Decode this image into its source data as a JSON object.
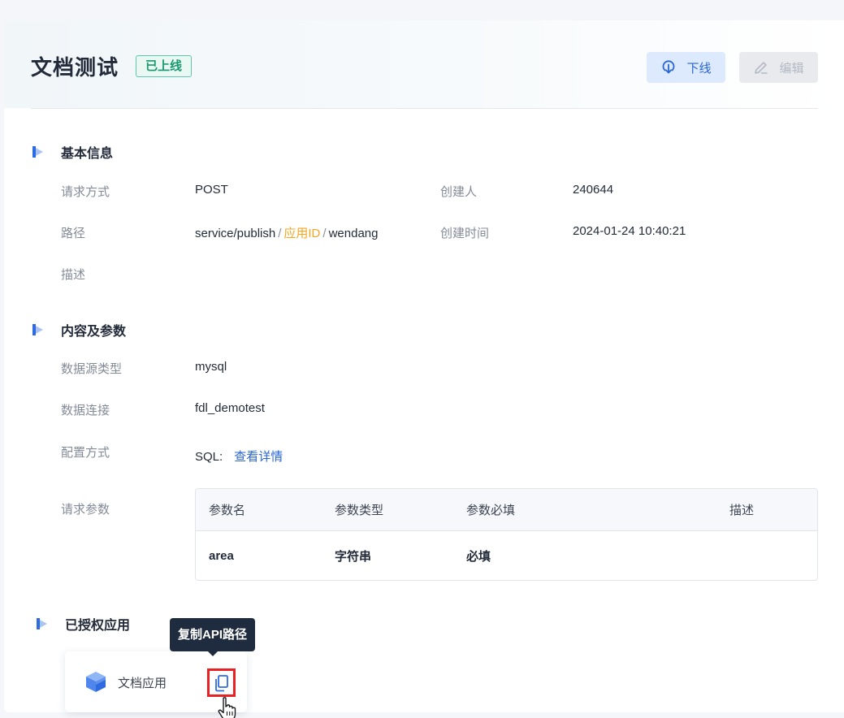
{
  "header": {
    "title": "文档测试",
    "status": "已上线",
    "offline_button": "下线",
    "edit_button": "编辑"
  },
  "basic_info": {
    "section_title": "基本信息",
    "request_method_label": "请求方式",
    "request_method_value": "POST",
    "creator_label": "创建人",
    "creator_value": "240644",
    "path_label": "路径",
    "path_prefix": "service/publish",
    "path_separator": "/",
    "path_variable": "应用ID",
    "path_suffix": "wendang",
    "created_time_label": "创建时间",
    "created_time_value": "2024-01-24 10:40:21",
    "description_label": "描述"
  },
  "content_params": {
    "section_title": "内容及参数",
    "datasource_type_label": "数据源类型",
    "datasource_type_value": "mysql",
    "data_connection_label": "数据连接",
    "data_connection_value": "fdl_demotest",
    "config_mode_label": "配置方式",
    "config_mode_value": "SQL:",
    "view_details_link": "查看详情",
    "request_params_label": "请求参数",
    "table": {
      "columns": [
        "参数名",
        "参数类型",
        "参数必填",
        "描述"
      ],
      "rows": [
        [
          "area",
          "字符串",
          "必填",
          ""
        ]
      ]
    }
  },
  "authorized_apps": {
    "section_title": "已授权应用",
    "apps": [
      {
        "name": "文档应用",
        "icon": "cube-icon"
      }
    ],
    "tooltip": "复制API路径",
    "copy_icon": "copy-icon"
  },
  "colors": {
    "accent": "#2966d4",
    "status_green": "#18996f",
    "path_variable": "#f5a623",
    "highlight_border": "#e82222"
  }
}
